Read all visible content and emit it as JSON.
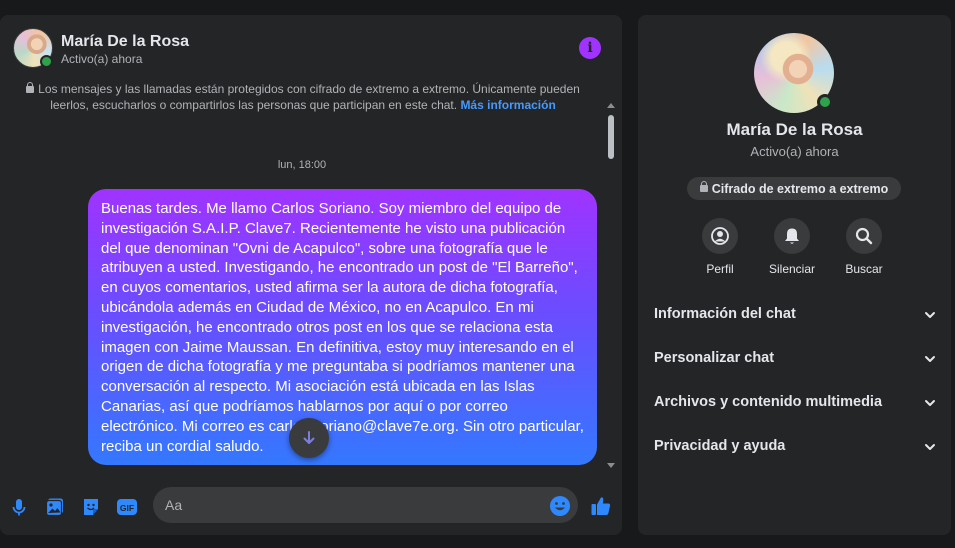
{
  "header": {
    "contact_name": "María De la Rosa",
    "contact_status": "Activo(a) ahora",
    "info_icon": "info-icon",
    "accent_color": "#a033ff"
  },
  "notice": {
    "text": "Los mensajes y las llamadas están protegidos con cifrado de extremo a extremo. Únicamente pueden leerlos, escucharlos o compartirlos las personas que participan en este chat.",
    "link_label": "Más información"
  },
  "conversation": {
    "timestamp": "lun, 18:00",
    "messages": [
      {
        "sender": "me",
        "text": "Buenas tardes. Me llamo Carlos Soriano. Soy miembro del equipo de investigación S.A.I.P. Clave7. Recientemente he visto una publicación del que denominan \"Ovni de Acapulco\", sobre una fotografía que le atribuyen a usted. Investigando, he encontrado un post de \"El Barreño\", en cuyos comentarios, usted afirma ser la autora de dicha fotografía, ubicándola además en Ciudad de México, no en Acapulco. En mi investigación, he encontrado otros post en los que se relaciona esta imagen con Jaime Maussan. En definitiva, estoy muy interesando en el origen de dicha fotografía y me preguntaba si podríamos mantener una conversación al respecto. Mi asociación está ubicada en las Islas Canarias, así que podríamos hablarnos por aquí o por correo electrónico. Mi correo es carlos.soriano@clave7e.org. Sin otro particular, reciba un cordial saludo."
      }
    ]
  },
  "composer": {
    "placeholder": "Aa",
    "icons": [
      "microphone-icon",
      "image-icon",
      "sticker-icon",
      "gif-icon",
      "emoji-icon",
      "like-icon"
    ],
    "gif_label": "GIF"
  },
  "side_panel": {
    "name": "María De la Rosa",
    "status": "Activo(a) ahora",
    "encryption_badge": "Cifrado de extremo a extremo",
    "actions": [
      {
        "label": "Perfil",
        "icon": "profile-icon"
      },
      {
        "label": "Silenciar",
        "icon": "bell-icon"
      },
      {
        "label": "Buscar",
        "icon": "search-icon"
      }
    ],
    "sections": [
      {
        "label": "Información del chat"
      },
      {
        "label": "Personalizar chat"
      },
      {
        "label": "Archivos y contenido multimedia"
      },
      {
        "label": "Privacidad y ayuda"
      }
    ]
  }
}
